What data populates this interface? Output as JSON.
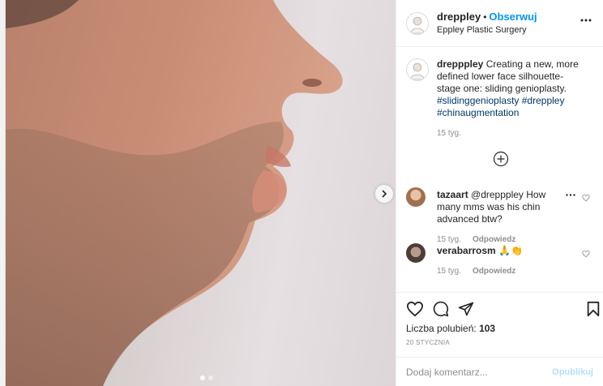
{
  "post": {
    "username": "dreppley",
    "separator": "•",
    "follow_label": "Obserwuj",
    "location": "Eppley Plastic Surgery"
  },
  "caption": {
    "username": "drepppley",
    "text": "Creating a new, more defined lower face silhouette- stage one: sliding genioplasty.",
    "hashtags": [
      "#slidinggenioplasty",
      "#dreppley",
      "#chinaugmentation"
    ],
    "time": "15 tyg."
  },
  "comments": [
    {
      "username": "tazaart",
      "text": "@drepppley How many mms was his chin advanced btw?",
      "time": "15 tyg.",
      "reply_label": "Odpowiedz",
      "avatar_color": "#c79a7e"
    },
    {
      "username": "verabarrosm",
      "text": "🙏👏",
      "time": "15 tyg.",
      "reply_label": "Odpowiedz",
      "avatar_color": "#7d6b60"
    }
  ],
  "likes": {
    "label": "Liczba polubień:",
    "count": "103"
  },
  "date": "20 STYCZNIA",
  "add_comment": {
    "placeholder": "Dodaj komentarz...",
    "publish_label": "Opublikuj"
  },
  "carousel": {
    "total": 2,
    "current": 1
  },
  "colors": {
    "accent": "#0095f6",
    "hashtag": "#00376b",
    "muted": "#8e8e8e"
  }
}
